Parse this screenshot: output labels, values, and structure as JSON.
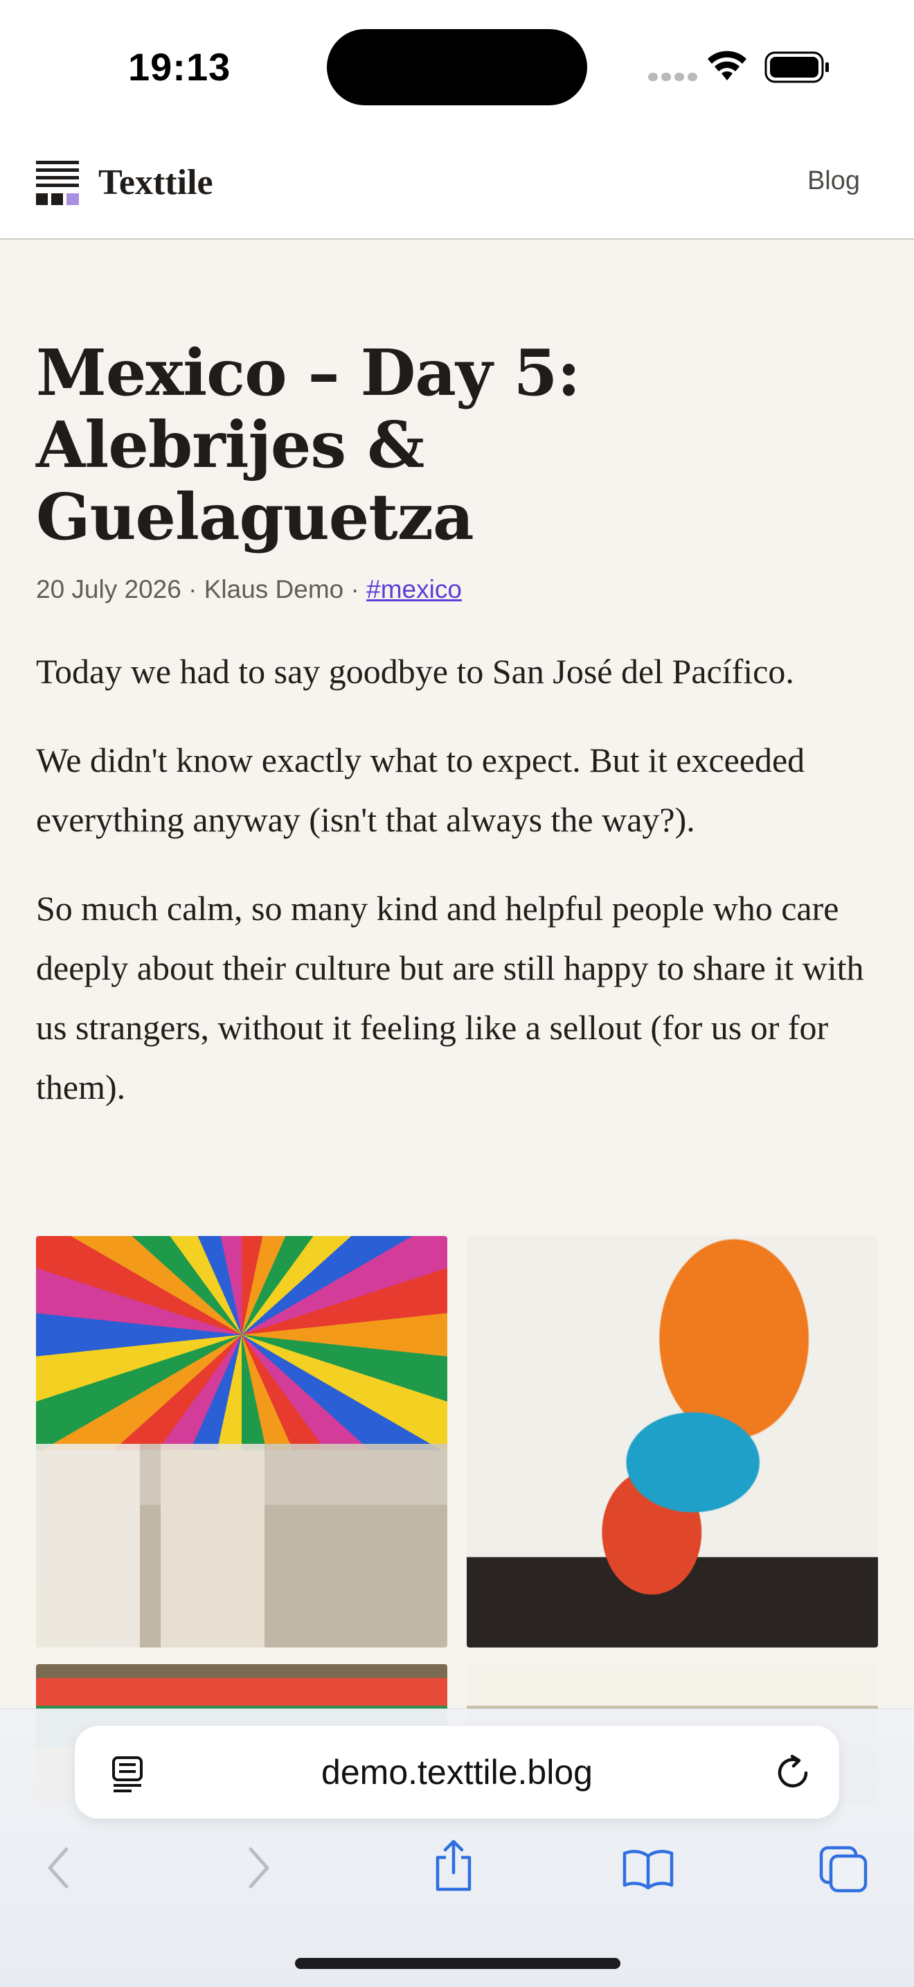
{
  "status_bar": {
    "time": "19:13"
  },
  "header": {
    "site_title": "Texttile",
    "nav_blog": "Blog"
  },
  "post": {
    "title": "Mexico – Day 5: Alebrijes & Guelaguetza",
    "date": "20 July 2026",
    "author": "Klaus Demo",
    "separator": "·",
    "tag": "#mexico",
    "paragraphs": [
      "Today we had to say goodbye to San José del Pacífico.",
      "We didn't know exactly what to expect. But it exceeded everything anyway (isn't that always the way?).",
      "So much calm, so many kind and helpful people who care deeply about their culture but are still happy to share it with us strangers, without it feeling like a sellout (for us or for them)."
    ]
  },
  "browser": {
    "url": "demo.texttile.blog",
    "icons": [
      "reader-icon",
      "reload-icon",
      "back-icon",
      "forward-icon",
      "share-icon",
      "bookmarks-icon",
      "tabs-icon"
    ],
    "accent": "#2f6fe0"
  },
  "colors": {
    "page_background": "#f6f4ef",
    "tag_link": "#5b3fd6"
  }
}
